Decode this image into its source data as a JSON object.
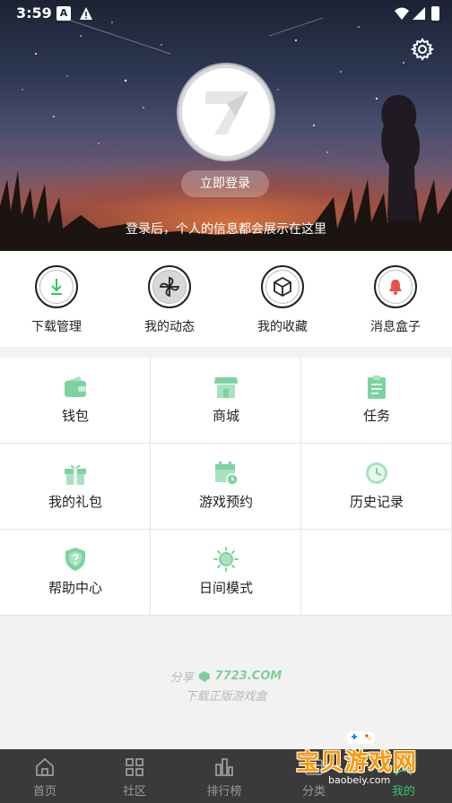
{
  "status_bar": {
    "time": "3:59",
    "a_icon_text": "A"
  },
  "hero": {
    "login_button": "立即登录",
    "hint": "登录后，个人的信息都会展示在这里"
  },
  "quick_actions": [
    {
      "label": "下载管理",
      "icon": "download-icon"
    },
    {
      "label": "我的动态",
      "icon": "pinwheel-icon"
    },
    {
      "label": "我的收藏",
      "icon": "box-icon"
    },
    {
      "label": "消息盒子",
      "icon": "bell-icon"
    }
  ],
  "grid": [
    {
      "label": "钱包",
      "icon": "wallet-icon"
    },
    {
      "label": "商城",
      "icon": "shop-icon"
    },
    {
      "label": "任务",
      "icon": "task-icon"
    },
    {
      "label": "我的礼包",
      "icon": "gift-icon"
    },
    {
      "label": "游戏预约",
      "icon": "calendar-icon"
    },
    {
      "label": "历史记录",
      "icon": "clock-icon"
    },
    {
      "label": "帮助中心",
      "icon": "help-shield-icon"
    },
    {
      "label": "日间模式",
      "icon": "sun-icon"
    }
  ],
  "share": {
    "prefix": "分享",
    "brand": "7723.COM",
    "tagline": "下载正版游戏盒"
  },
  "tabs": [
    {
      "label": "首页",
      "icon": "home-icon",
      "active": false
    },
    {
      "label": "社区",
      "icon": "community-icon",
      "active": false
    },
    {
      "label": "排行榜",
      "icon": "ranking-icon",
      "active": false
    },
    {
      "label": "分类",
      "icon": "category-icon",
      "active": false
    },
    {
      "label": "我的",
      "icon": "profile-icon",
      "active": true
    }
  ],
  "watermark": {
    "title": "宝贝游戏网",
    "url": "baobeiy.com"
  },
  "colors": {
    "accent_green": "#36c46b",
    "icon_green": "#7dd3a0",
    "tabbar_bg": "#3a3a3a"
  }
}
